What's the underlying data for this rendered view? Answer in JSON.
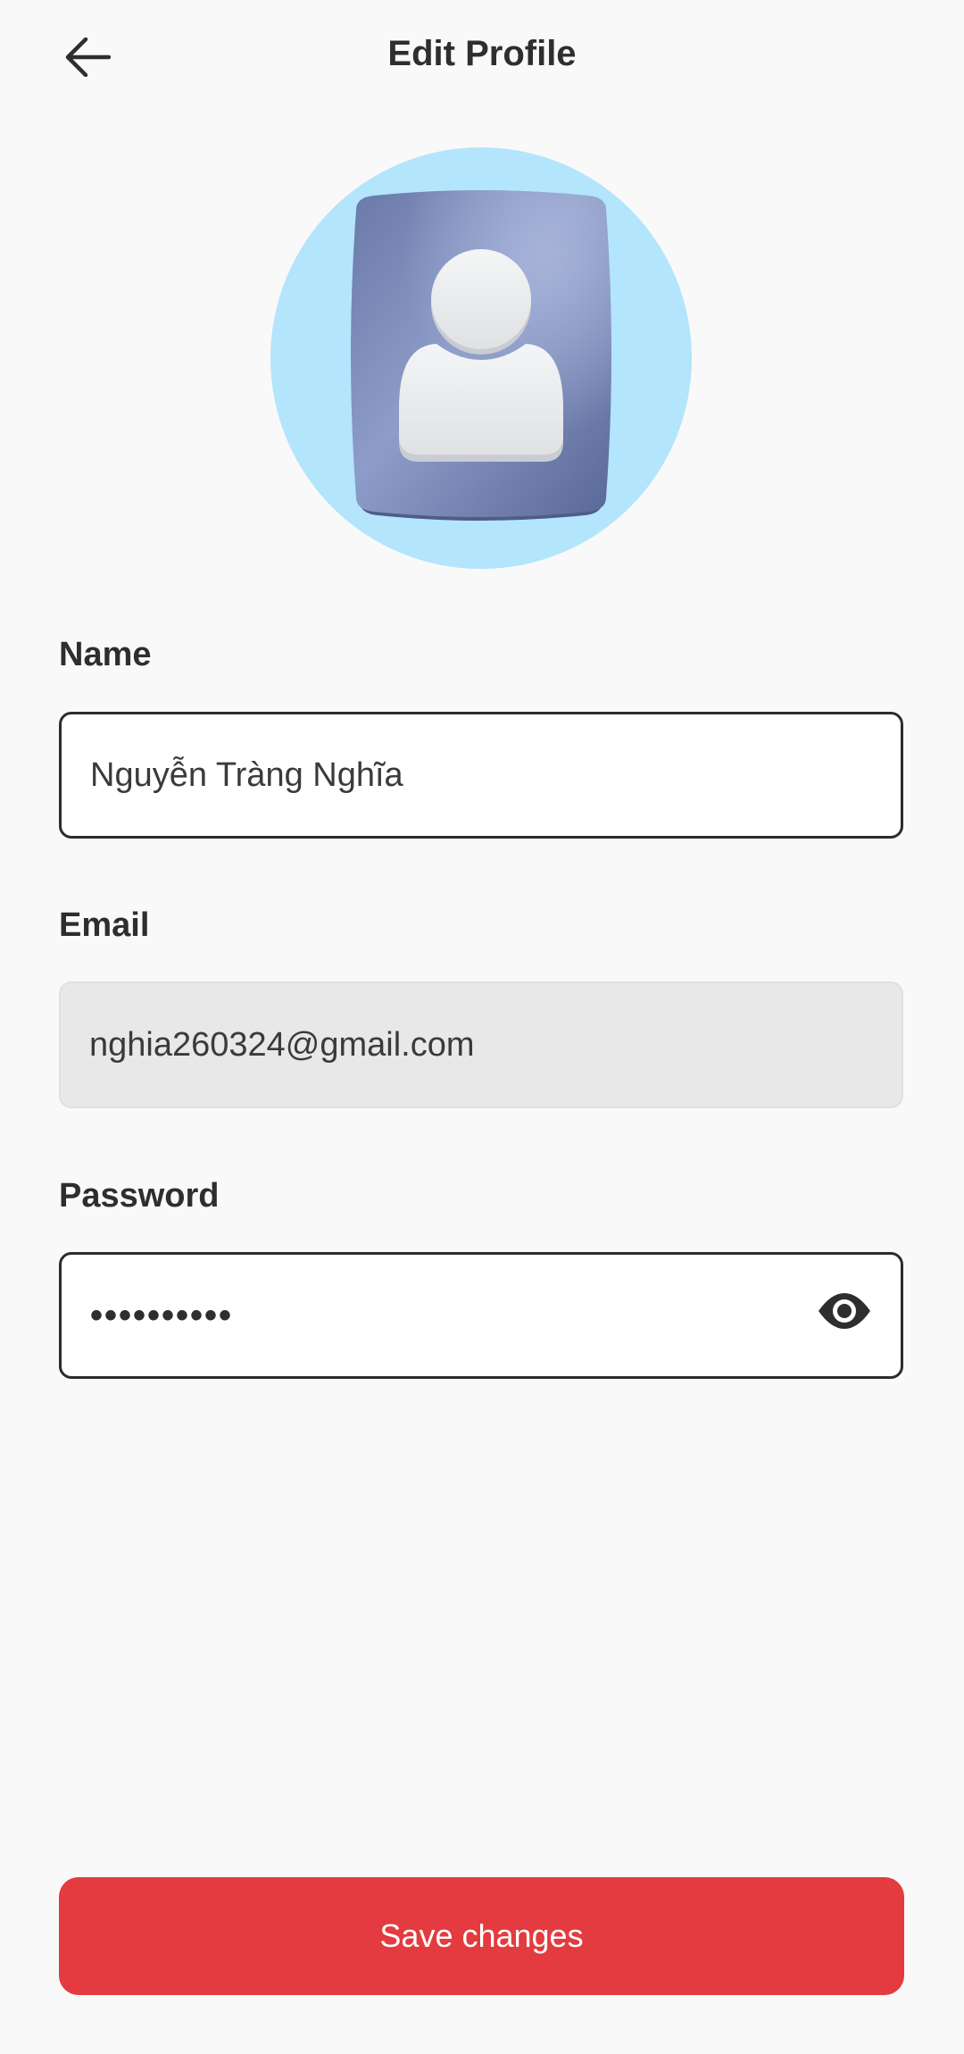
{
  "header": {
    "title": "Edit Profile",
    "back_icon": "arrow-left-icon"
  },
  "avatar": {
    "icon": "user-avatar-icon",
    "background_color": "#b3e5fc",
    "tile_color": "#7384b4"
  },
  "form": {
    "name": {
      "label": "Name",
      "value": "Nguyễn Tràng Nghĩa"
    },
    "email": {
      "label": "Email",
      "value": "nghia260324@gmail.com",
      "disabled": true
    },
    "password": {
      "label": "Password",
      "masked_value": "••••••••••",
      "toggle_icon": "eye-icon"
    }
  },
  "actions": {
    "save_label": "Save changes",
    "save_color": "#e33b3f"
  }
}
